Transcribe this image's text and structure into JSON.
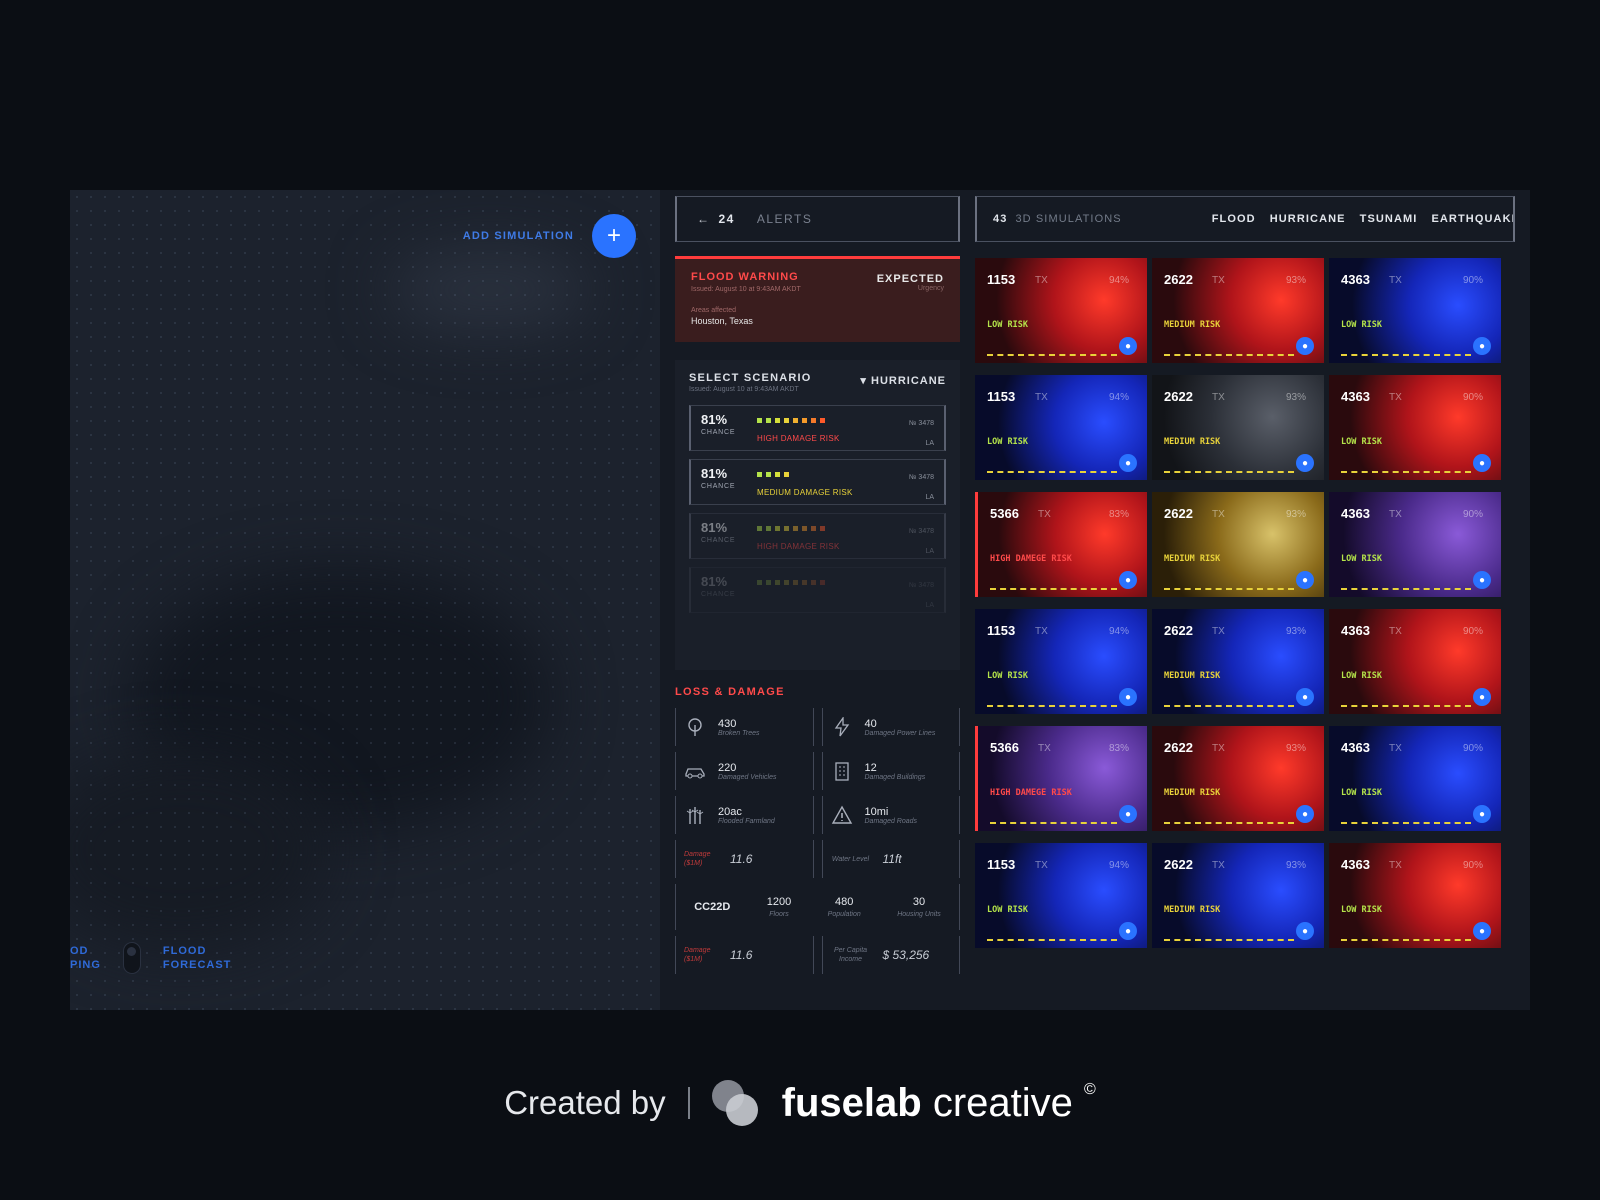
{
  "map": {
    "add_label": "ADD SIMULATION",
    "add_icon": "+",
    "left_label": "OD\nPING",
    "forecast_label": "FLOOD\nFORECAST"
  },
  "alerts": {
    "back_arrow": "←",
    "count": "24",
    "title": "ALERTS",
    "flood": {
      "title": "FLOOD WARNING",
      "issued": "Issued: August 10 at 9:43AM AKDT",
      "areas_label": "Areas affected",
      "area": "Houston, Texas",
      "status": "EXPECTED",
      "status_sub": "Urgency"
    },
    "scenario": {
      "title": "SELECT SCENARIO",
      "issued": "Issued: August 10 at 9:43AM AKDT",
      "selected": "▾ HURRICANE",
      "rows": [
        {
          "pct": "81%",
          "chance": "CHANCE",
          "risk": "HIGH DAMAGE RISK",
          "no": "№ 3478",
          "code": "LA"
        },
        {
          "pct": "81%",
          "chance": "CHANCE",
          "risk": "MEDIUM DAMAGE RISK",
          "no": "№ 3478",
          "code": "LA"
        },
        {
          "pct": "81%",
          "chance": "CHANCE",
          "risk": "HIGH DAMAGE RISK",
          "no": "№ 3478",
          "code": "LA"
        },
        {
          "pct": "81%",
          "chance": "CHANCE",
          "risk": "",
          "no": "№ 3478",
          "code": "LA"
        }
      ]
    },
    "loss": {
      "title": "LOSS & DAMAGE",
      "items": [
        {
          "icon": "tree-icon",
          "value": "430",
          "desc": "Broken Trees"
        },
        {
          "icon": "lightning-icon",
          "value": "40",
          "desc": "Damaged Power Lines"
        },
        {
          "icon": "car-icon",
          "value": "220",
          "desc": "Damaged Vehicles"
        },
        {
          "icon": "building-icon",
          "value": "12",
          "desc": "Damaged Buildings"
        },
        {
          "icon": "crop-icon",
          "value": "20ac",
          "desc": "Flooded Farmland"
        },
        {
          "icon": "warning-icon",
          "value": "10mi",
          "desc": "Damaged Roads"
        }
      ],
      "damage_label": "Damage ($1M)",
      "damage_value": "11.6",
      "water_label": "Water Level",
      "water_value": "11ft",
      "zone": "CC22D",
      "floors": "1200",
      "floors_label": "Floors",
      "population": "480",
      "population_label": "Population",
      "housing": "30",
      "housing_label": "Housing Units",
      "damage2_label": "Damage ($1M)",
      "damage2_value": "11.6",
      "income_label": "Per Capita Income",
      "income_value": "$ 53,256"
    }
  },
  "sims": {
    "count": "43",
    "title": "3D SIMULATIONS",
    "filters": [
      "FLOOD",
      "HURRICANE",
      "TSUNAMI",
      "EARTHQUAKE"
    ],
    "cards": [
      {
        "num": "1153",
        "state": "TX",
        "pct": "94%",
        "risk": "LOW RISK",
        "tone": "red",
        "level": "low"
      },
      {
        "num": "2622",
        "state": "TX",
        "pct": "93%",
        "risk": "MEDIUM RISK",
        "tone": "red",
        "level": "medium"
      },
      {
        "num": "4363",
        "state": "TX",
        "pct": "90%",
        "risk": "LOW RISK",
        "tone": "blue",
        "level": "low"
      },
      {
        "num": "1153",
        "state": "TX",
        "pct": "94%",
        "risk": "LOW RISK",
        "tone": "blue",
        "level": "low"
      },
      {
        "num": "2622",
        "state": "TX",
        "pct": "93%",
        "risk": "MEDIUM RISK",
        "tone": "gray",
        "level": "medium"
      },
      {
        "num": "4363",
        "state": "TX",
        "pct": "90%",
        "risk": "LOW RISK",
        "tone": "red",
        "level": "low"
      },
      {
        "num": "5366",
        "state": "TX",
        "pct": "83%",
        "risk": "HIGH DAMEGE RISK",
        "tone": "red",
        "level": "high"
      },
      {
        "num": "2622",
        "state": "TX",
        "pct": "93%",
        "risk": "MEDIUM RISK",
        "tone": "yellow",
        "level": "medium"
      },
      {
        "num": "4363",
        "state": "TX",
        "pct": "90%",
        "risk": "LOW RISK",
        "tone": "purple",
        "level": "low"
      },
      {
        "num": "1153",
        "state": "TX",
        "pct": "94%",
        "risk": "LOW RISK",
        "tone": "blue",
        "level": "low"
      },
      {
        "num": "2622",
        "state": "TX",
        "pct": "93%",
        "risk": "MEDIUM RISK",
        "tone": "blue",
        "level": "medium"
      },
      {
        "num": "4363",
        "state": "TX",
        "pct": "90%",
        "risk": "LOW RISK",
        "tone": "red",
        "level": "low"
      },
      {
        "num": "5366",
        "state": "TX",
        "pct": "83%",
        "risk": "HIGH DAMEGE RISK",
        "tone": "purple",
        "level": "high"
      },
      {
        "num": "2622",
        "state": "TX",
        "pct": "93%",
        "risk": "MEDIUM RISK",
        "tone": "red",
        "level": "medium"
      },
      {
        "num": "4363",
        "state": "TX",
        "pct": "90%",
        "risk": "LOW RISK",
        "tone": "blue",
        "level": "low"
      },
      {
        "num": "1153",
        "state": "TX",
        "pct": "94%",
        "risk": "LOW RISK",
        "tone": "blue",
        "level": "low"
      },
      {
        "num": "2622",
        "state": "TX",
        "pct": "93%",
        "risk": "MEDIUM RISK",
        "tone": "blue",
        "level": "medium"
      },
      {
        "num": "4363",
        "state": "TX",
        "pct": "90%",
        "risk": "LOW RISK",
        "tone": "red",
        "level": "low"
      }
    ]
  },
  "footer": {
    "created_by": "Created by",
    "brand_bold": "fuselab",
    "brand_light": "creative",
    "copyright": "©"
  },
  "colors": {
    "accent_blue": "#2a73ff",
    "alert_red": "#ff3c3c",
    "risk_green": "#b4e34a",
    "risk_yellow": "#e8d23a",
    "risk_red": "#ff4a4a"
  }
}
